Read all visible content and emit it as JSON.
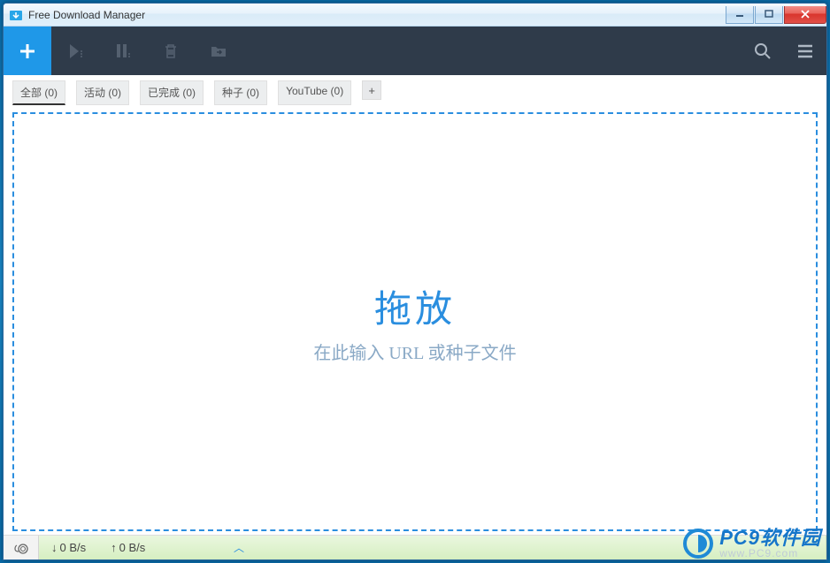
{
  "window": {
    "title": "Free Download Manager"
  },
  "tabs": [
    {
      "label": "全部 (0)",
      "active": true
    },
    {
      "label": "活动 (0)",
      "active": false
    },
    {
      "label": "已完成 (0)",
      "active": false
    },
    {
      "label": "种子 (0)",
      "active": false
    },
    {
      "label": "YouTube (0)",
      "active": false
    }
  ],
  "dropzone": {
    "title": "拖放",
    "subtitle": "在此输入 URL 或种子文件"
  },
  "status": {
    "download_speed": "0 B/s",
    "upload_speed": "0 B/s"
  },
  "watermark": {
    "main": "PC9软件园",
    "sub": "www.PC9.com"
  }
}
